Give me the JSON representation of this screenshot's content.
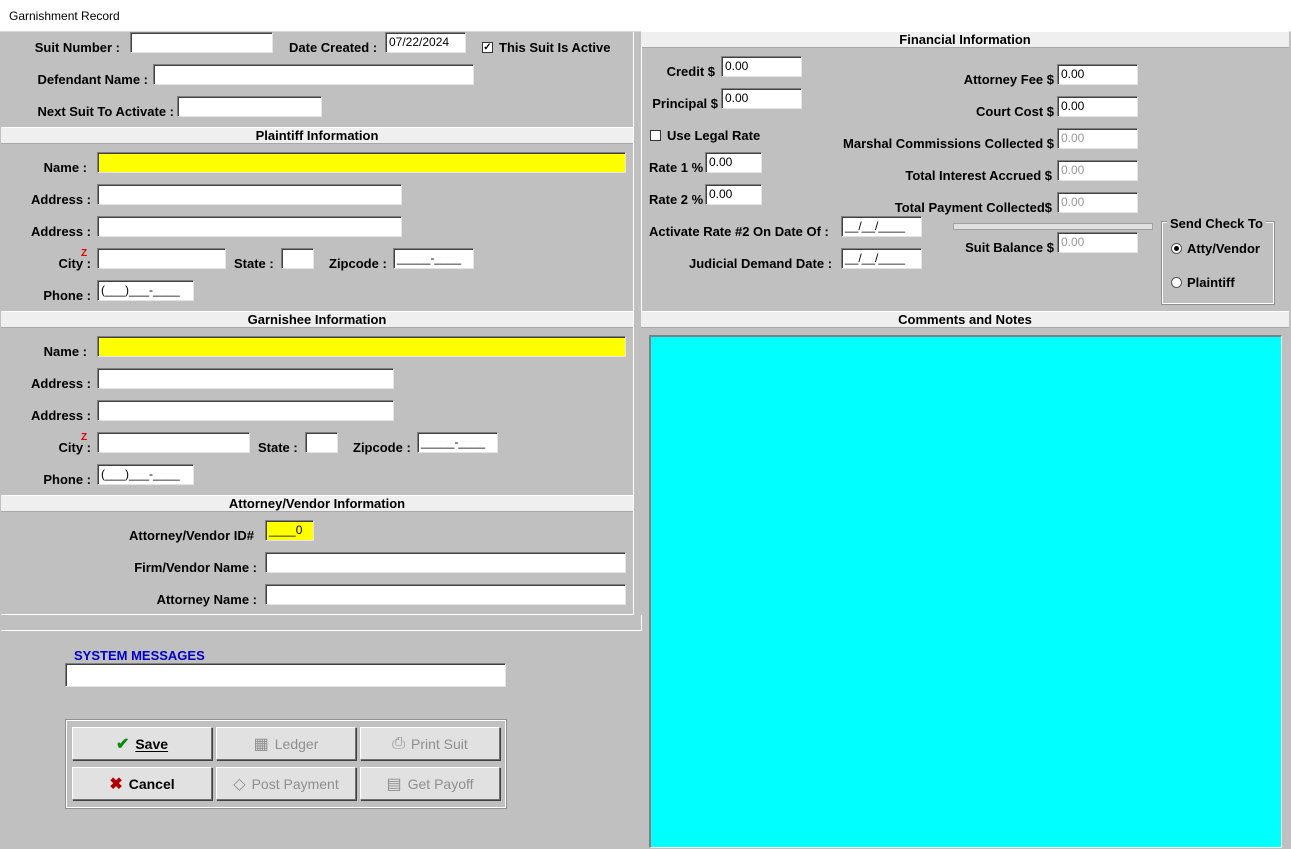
{
  "window": {
    "title": "Garnishment Record"
  },
  "header": {
    "suit_number_label": "Suit Number :",
    "suit_number_value": "",
    "date_created_label": "Date Created :",
    "date_created_value": "07/22/2024",
    "active_label": "This Suit Is Active",
    "active_checked": "✓",
    "defendant_label": "Defendant Name :",
    "defendant_value": "",
    "next_suit_label": "Next Suit To Activate :",
    "next_suit_value": ""
  },
  "plaintiff": {
    "title": "Plaintiff Information",
    "name_label": "Name :",
    "address1_label": "Address :",
    "address2_label": "Address :",
    "city_label": "City :",
    "state_label": "State :",
    "zip_label": "Zipcode :",
    "zip_value": "_____-____",
    "phone_label": "Phone :",
    "phone_value": "(___)___-____",
    "z_marker": "Z"
  },
  "garnishee": {
    "title": "Garnishee Information",
    "name_label": "Name :",
    "address1_label": "Address :",
    "address2_label": "Address :",
    "city_label": "City :",
    "state_label": "State :",
    "zip_label": "Zipcode :",
    "zip_value": "_____-____",
    "phone_label": "Phone :",
    "phone_value": "(___)___-____",
    "z_marker": "Z"
  },
  "attorney": {
    "title": "Attorney/Vendor Information",
    "id_label": "Attorney/Vendor  ID#",
    "id_value": "____0",
    "firm_label": "Firm/Vendor Name :",
    "name_label": "Attorney Name :"
  },
  "system_messages": {
    "label": "SYSTEM MESSAGES",
    "value": ""
  },
  "buttons": {
    "save": "Save",
    "ledger": "Ledger",
    "print_suit": "Print Suit",
    "cancel": "Cancel",
    "post_payment": "Post Payment",
    "get_payoff": "Get Payoff"
  },
  "financial": {
    "title": "Financial Information",
    "credit_label": "Credit $",
    "credit_value": "0.00",
    "principal_label": "Principal $",
    "principal_value": "0.00",
    "legal_rate_label": "Use Legal Rate",
    "rate1_label": "Rate 1 %",
    "rate1_value": "0.00",
    "rate2_label": "Rate 2 %",
    "rate2_value": "0.00",
    "activate_rate_label": "Activate Rate #2 On Date Of :",
    "activate_rate_value": "__/__/____",
    "judicial_label": "Judicial Demand Date :",
    "judicial_value": "__/__/____",
    "attorney_fee_label": "Attorney Fee $",
    "attorney_fee_value": "0.00",
    "court_cost_label": "Court Cost $",
    "court_cost_value": "0.00",
    "marshal_label": "Marshal Commissions Collected  $",
    "marshal_value": "0.00",
    "interest_label": "Total Interest Accrued $",
    "interest_value": "0.00",
    "payment_label": "Total Payment Collected$",
    "payment_value": "0.00",
    "balance_label": "Suit Balance $",
    "balance_value": "0.00",
    "send_check_title": "Send Check To",
    "send_atty": "Atty/Vendor",
    "send_plaintiff": "Plaintiff"
  },
  "comments": {
    "title": "Comments and Notes",
    "bg": "#00ffff"
  },
  "colors": {
    "required_field": "#ffff00",
    "system_messages": "#0000cc",
    "comments": "#00ffff"
  }
}
